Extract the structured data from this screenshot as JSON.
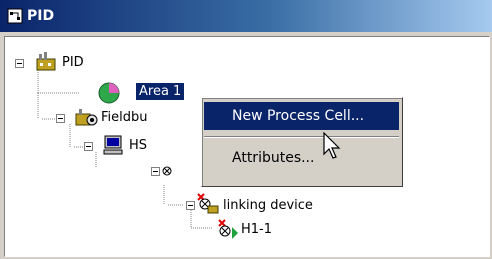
{
  "window": {
    "title": "PID"
  },
  "tree": {
    "root": "PID",
    "area": "Area 1",
    "fieldbus": "Fieldbu",
    "hs": "HS",
    "linking_device": "linking device",
    "h1": "H1-1"
  },
  "context_menu": {
    "items": [
      {
        "label": "New Process Cell..."
      },
      {
        "label": "Attributes..."
      }
    ]
  },
  "colors": {
    "selection": "#0a246a",
    "titlebar": "#0a246a",
    "face": "#d4d0c8"
  }
}
